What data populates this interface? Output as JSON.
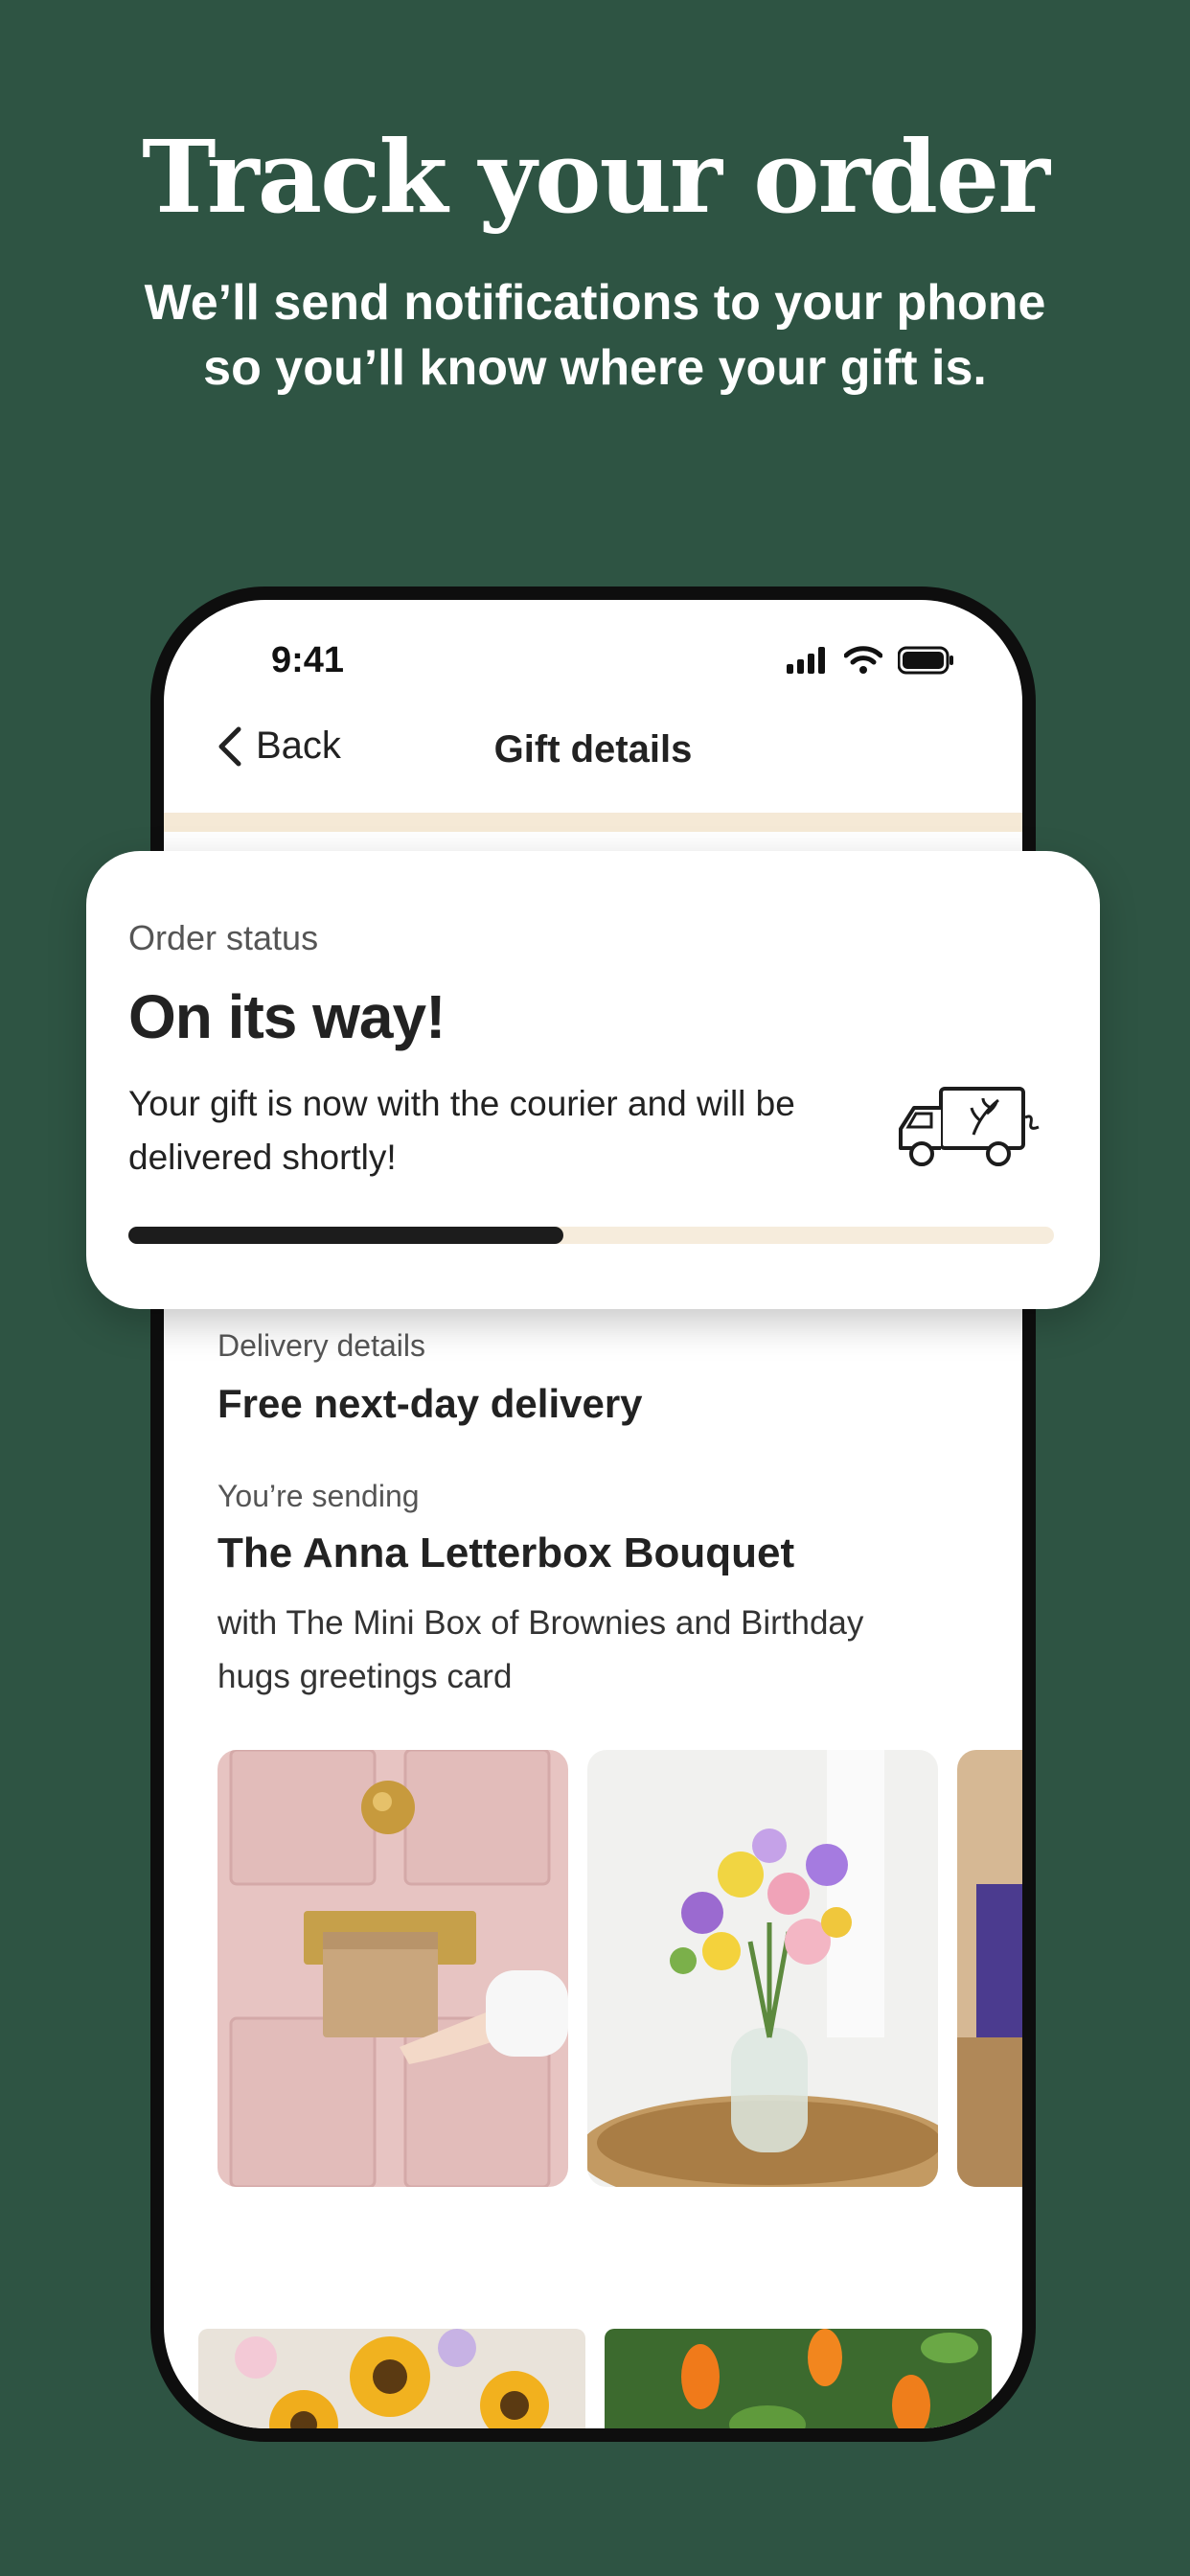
{
  "promo": {
    "headline": "Track your order",
    "subline_1": "We’ll send notifications to your phone",
    "subline_2": "so you’ll know where your gift is."
  },
  "status_bar": {
    "time": "9:41"
  },
  "nav": {
    "back_label": "Back",
    "title": "Gift details"
  },
  "order_status": {
    "label": "Order status",
    "title": "On its way!",
    "description": "Your gift is now with the courier and will be delivered shortly!",
    "progress": 0.47
  },
  "delivery": {
    "label": "Delivery details",
    "value": "Free next-day delivery"
  },
  "sending": {
    "label": "You’re sending",
    "product": "The Anna Letterbox Bouquet",
    "extras": "with The Mini Box of Brownies and Birthday hugs greetings card"
  },
  "colors": {
    "background": "#2e5443",
    "accent_beige": "#f5e9d6",
    "progress": "#1c1c1c"
  },
  "icons": [
    "chevron-left-icon",
    "signal-icon",
    "wifi-icon",
    "battery-icon",
    "delivery-truck-icon"
  ]
}
